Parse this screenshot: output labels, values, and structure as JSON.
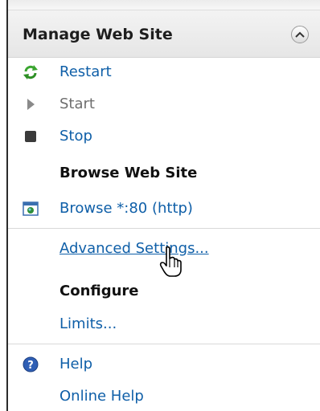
{
  "header": {
    "title": "Manage Web Site",
    "collapse_icon": "chevron-up-icon"
  },
  "actions": {
    "restart": {
      "label": "Restart",
      "icon": "refresh-icon",
      "color": "#0f5fa8"
    },
    "start": {
      "label": "Start",
      "icon": "play-icon",
      "enabled": false
    },
    "stop": {
      "label": "Stop",
      "icon": "stop-icon"
    }
  },
  "browse_section": {
    "heading": "Browse Web Site",
    "browse_link": "Browse *:80 (http)",
    "browse_icon": "browser-window-icon"
  },
  "advanced_settings": {
    "label": "Advanced Settings...",
    "hovered": true
  },
  "configure_section": {
    "heading": "Configure",
    "limits_link": "Limits..."
  },
  "help_section": {
    "help_link": "Help",
    "help_icon": "help-icon",
    "online_help_link": "Online Help"
  },
  "colors": {
    "link": "#0f5fa8",
    "disabled": "#6e6e6e",
    "heading": "#111111"
  }
}
